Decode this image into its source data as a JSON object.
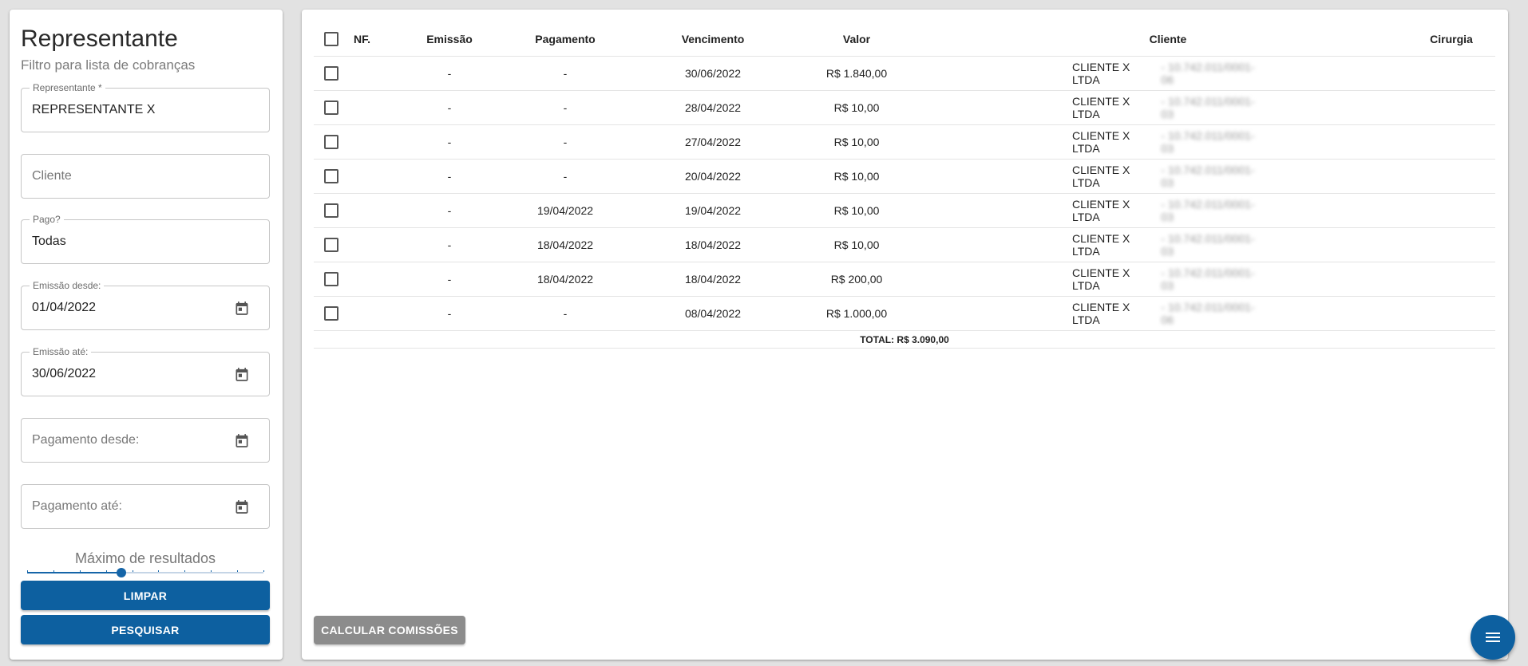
{
  "filter": {
    "title": "Representante",
    "subtitle": "Filtro para lista de cobranças",
    "representante": {
      "label": "Representante *",
      "value": "REPRESENTANTE X"
    },
    "cliente": {
      "placeholder": "Cliente"
    },
    "pago": {
      "label": "Pago?",
      "value": "Todas"
    },
    "emissao_desde": {
      "label": "Emissão desde:",
      "value": "01/04/2022"
    },
    "emissao_ate": {
      "label": "Emissão até:",
      "value": "30/06/2022"
    },
    "pagamento_desde": {
      "placeholder": "Pagamento desde:"
    },
    "pagamento_ate": {
      "placeholder": "Pagamento até:"
    },
    "max_results": {
      "label": "Máximo de resultados",
      "level_fraction": 0.4
    },
    "clear_label": "LIMPAR",
    "search_label": "PESQUISAR",
    "icons": {
      "date_picker": "calendar-icon"
    }
  },
  "table": {
    "headers": {
      "nf": "NF.",
      "emissao": "Emissão",
      "pagamento": "Pagamento",
      "vencimento": "Vencimento",
      "valor": "Valor",
      "cliente": "Cliente",
      "cirurgia": "Cirurgia"
    },
    "rows": [
      {
        "emissao": "-",
        "pagamento": "-",
        "vencimento": "30/06/2022",
        "valor": "R$ 1.840,00",
        "cliente": "CLIENTE X LTDA",
        "cliente_blur": "- 10.742.011/0001-06"
      },
      {
        "emissao": "-",
        "pagamento": "-",
        "vencimento": "28/04/2022",
        "valor": "R$ 10,00",
        "cliente": "CLIENTE X LTDA",
        "cliente_blur": "- 10.742.011/0001-03"
      },
      {
        "emissao": "-",
        "pagamento": "-",
        "vencimento": "27/04/2022",
        "valor": "R$ 10,00",
        "cliente": "CLIENTE X LTDA",
        "cliente_blur": "- 10.742.011/0001-03"
      },
      {
        "emissao": "-",
        "pagamento": "-",
        "vencimento": "20/04/2022",
        "valor": "R$ 10,00",
        "cliente": "CLIENTE X LTDA",
        "cliente_blur": "- 10.742.011/0001-03"
      },
      {
        "emissao": "-",
        "pagamento": "19/04/2022",
        "vencimento": "19/04/2022",
        "valor": "R$ 10,00",
        "cliente": "CLIENTE X LTDA",
        "cliente_blur": "- 10.742.011/0001-03"
      },
      {
        "emissao": "-",
        "pagamento": "18/04/2022",
        "vencimento": "18/04/2022",
        "valor": "R$ 10,00",
        "cliente": "CLIENTE X LTDA",
        "cliente_blur": "- 10.742.011/0001-03"
      },
      {
        "emissao": "-",
        "pagamento": "18/04/2022",
        "vencimento": "18/04/2022",
        "valor": "R$ 200,00",
        "cliente": "CLIENTE X LTDA",
        "cliente_blur": "- 10.742.011/0001-03"
      },
      {
        "emissao": "-",
        "pagamento": "-",
        "vencimento": "08/04/2022",
        "valor": "R$ 1.000,00",
        "cliente": "CLIENTE X LTDA",
        "cliente_blur": "- 10.742.011/0001-06"
      }
    ],
    "total": "TOTAL: R$ 3.090,00",
    "calc_label": "CALCULAR COMISSÕES"
  },
  "fab": {
    "icon": "menu-icon"
  },
  "colors": {
    "primary": "#0d60a0",
    "disabled": "#8c8c8c"
  }
}
